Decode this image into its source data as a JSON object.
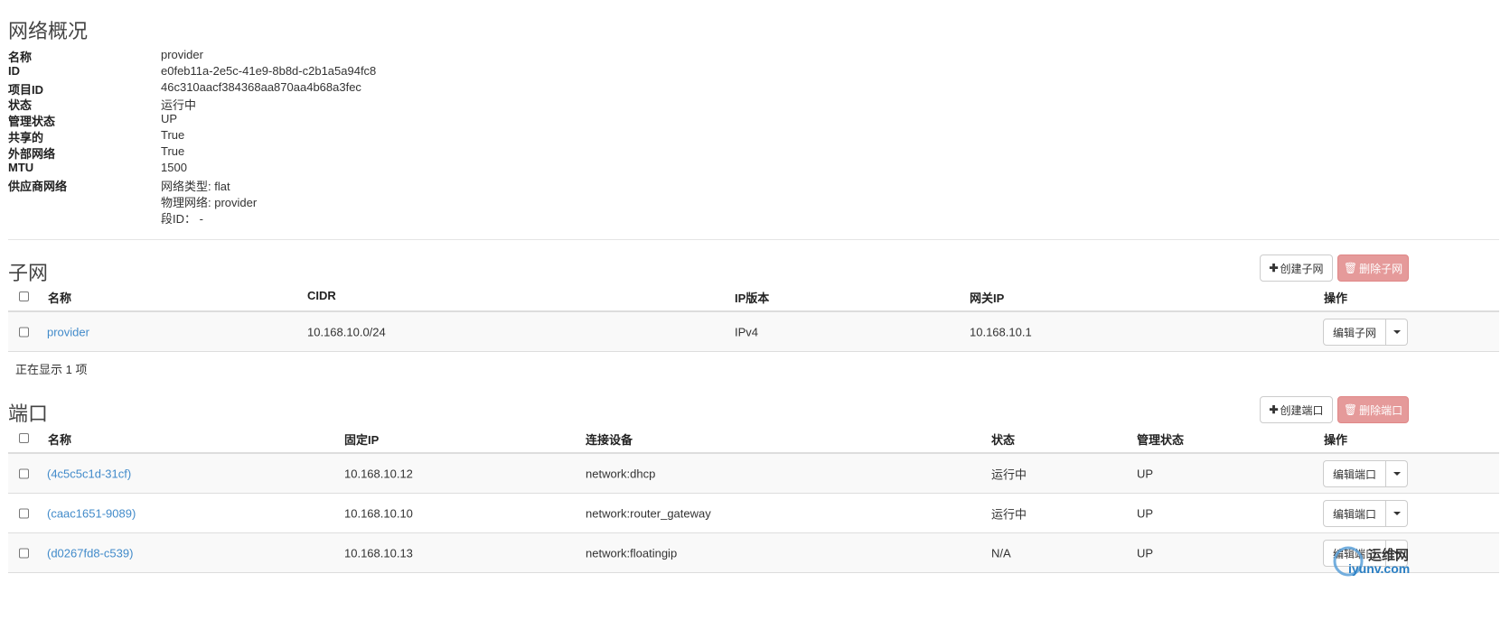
{
  "overview": {
    "title": "网络概况",
    "fields": [
      {
        "label": "名称",
        "value": "provider"
      },
      {
        "label": "ID",
        "value": "e0feb11a-2e5c-41e9-8b8d-c2b1a5a94fc8"
      },
      {
        "label": "项目ID",
        "value": "46c310aacf384368aa870aa4b68a3fec"
      },
      {
        "label": "状态",
        "value": "运行中"
      },
      {
        "label": "管理状态",
        "value": "UP"
      },
      {
        "label": "共享的",
        "value": "True"
      },
      {
        "label": "外部网络",
        "value": "True"
      },
      {
        "label": "MTU",
        "value": "1500"
      },
      {
        "label": "供应商网络",
        "value": "网络类型: flat"
      }
    ],
    "provider_extra": [
      "物理网络: provider",
      "段ID： -"
    ]
  },
  "subnets": {
    "title": "子网",
    "create_label": "创建子网",
    "delete_label": "删除子网",
    "headers": [
      "名称",
      "CIDR",
      "IP版本",
      "网关IP",
      "操作"
    ],
    "rows": [
      {
        "name": "provider",
        "cidr": "10.168.10.0/24",
        "ip_version": "IPv4",
        "gateway": "10.168.10.1",
        "action": "编辑子网"
      }
    ],
    "footer": "正在显示 1 项"
  },
  "ports": {
    "title": "端口",
    "create_label": "创建端口",
    "delete_label": "删除端口",
    "headers": [
      "名称",
      "固定IP",
      "连接设备",
      "状态",
      "管理状态",
      "操作"
    ],
    "rows": [
      {
        "name": "(4c5c5c1d-31cf)",
        "ip": "10.168.10.12",
        "device": "network:dhcp",
        "status": "运行中",
        "admin": "UP",
        "action": "编辑端口"
      },
      {
        "name": "(caac1651-9089)",
        "ip": "10.168.10.10",
        "device": "network:router_gateway",
        "status": "运行中",
        "admin": "UP",
        "action": "编辑端口"
      },
      {
        "name": "(d0267fd8-c539)",
        "ip": "10.168.10.13",
        "device": "network:floatingip",
        "status": "N/A",
        "admin": "UP",
        "action": "编辑端口"
      }
    ]
  },
  "watermark": {
    "text1": "运维网",
    "text2": "iyunv.com"
  }
}
